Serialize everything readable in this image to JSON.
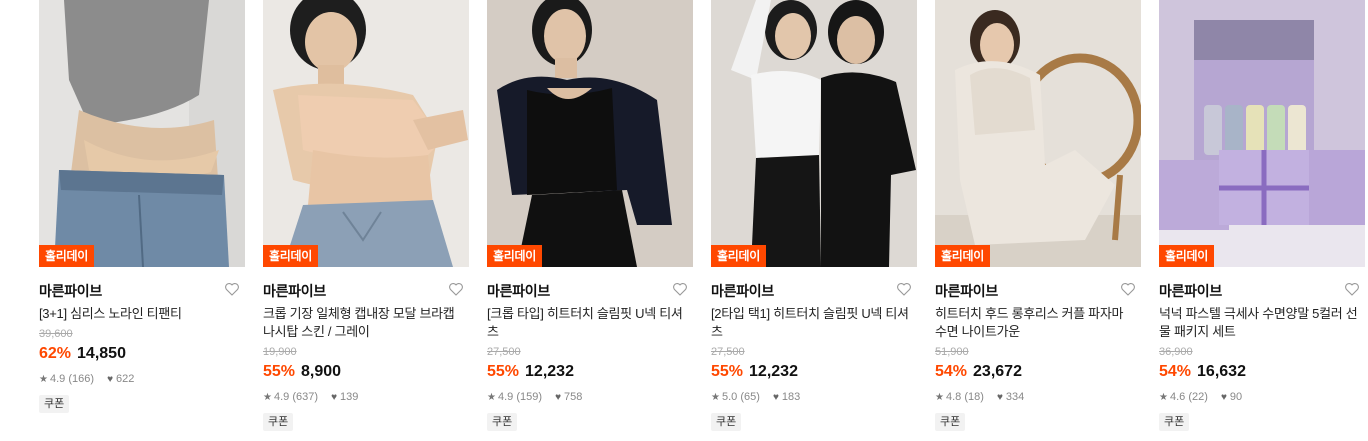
{
  "products": [
    {
      "tag": "홀리데이",
      "brand": "마른파이브",
      "title": "[3+1] 심리스 노라인 티팬티",
      "original_price": "39,600",
      "discount": "62%",
      "price": "14,850",
      "rating": "4.9",
      "reviews": "(166)",
      "likes": "622",
      "coupon": "쿠폰"
    },
    {
      "tag": "홀리데이",
      "brand": "마른파이브",
      "title": "크롭 기장 일체형 캡내장 모달 브라캡 나시탑 스킨 / 그레이",
      "original_price": "19,900",
      "discount": "55%",
      "price": "8,900",
      "rating": "4.9",
      "reviews": "(637)",
      "likes": "139",
      "coupon": "쿠폰"
    },
    {
      "tag": "홀리데이",
      "brand": "마른파이브",
      "title": "[크롭 타입] 히트터치 슬림핏 U넥 티셔츠",
      "original_price": "27,500",
      "discount": "55%",
      "price": "12,232",
      "rating": "4.9",
      "reviews": "(159)",
      "likes": "758",
      "coupon": "쿠폰"
    },
    {
      "tag": "홀리데이",
      "brand": "마른파이브",
      "title": "[2타입 택1] 히트터치 슬림핏 U넥 티셔츠",
      "original_price": "27,500",
      "discount": "55%",
      "price": "12,232",
      "rating": "5.0",
      "reviews": "(65)",
      "likes": "183",
      "coupon": "쿠폰"
    },
    {
      "tag": "홀리데이",
      "brand": "마른파이브",
      "title": "히트터치 후드 롱후리스 커플 파자마 수면 나이트가운",
      "original_price": "51,900",
      "discount": "54%",
      "price": "23,672",
      "rating": "4.8",
      "reviews": "(18)",
      "likes": "334",
      "coupon": "쿠폰"
    },
    {
      "tag": "홀리데이",
      "brand": "마른파이브",
      "title": "넉넉 파스텔 극세사 수면양말 5컬러 선물 패키지 세트",
      "original_price": "36,900",
      "discount": "54%",
      "price": "16,632",
      "rating": "4.6",
      "reviews": "(22)",
      "likes": "90",
      "coupon": "쿠폰"
    }
  ],
  "colors": {
    "accent": "#ff4800",
    "tag_bg": "#ff4800"
  },
  "icons": {
    "wishlist": "heart-outline-icon",
    "rating": "star-icon",
    "likes": "heart-filled-icon"
  }
}
